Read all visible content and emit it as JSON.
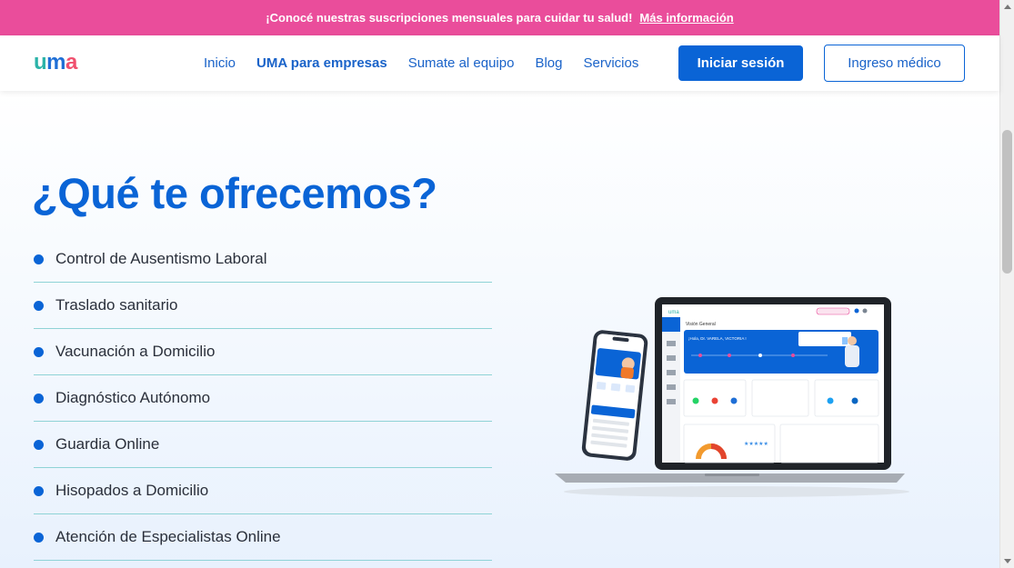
{
  "promo": {
    "text": "¡Conocé nuestras suscripciones mensuales para cuidar tu salud!",
    "link": "Más información"
  },
  "header": {
    "logo": {
      "u": "u",
      "m": "m",
      "a": "a"
    },
    "nav": [
      "Inicio",
      "UMA para empresas",
      "Sumate al equipo",
      "Blog",
      "Servicios"
    ],
    "login_label": "Iniciar sesión",
    "medico_label": "Ingreso médico"
  },
  "main": {
    "title": "¿Qué te ofrecemos?",
    "services": [
      "Control de Ausentismo Laboral",
      "Traslado sanitario",
      "Vacunación a Domicilio",
      "Diagnóstico Autónomo",
      "Guardia Online",
      "Hisopados a Domicilio",
      "Atención de Especialistas Online"
    ]
  },
  "mockup": {
    "dashboard_title": "Visión General",
    "greeting": "¡Hola, Dr. VARELA, VICTORIA !"
  },
  "colors": {
    "brand": "#0a64d6",
    "promo": "#ea4d9b",
    "divider": "#8fd3d6"
  },
  "icons": [
    "laptop-icon",
    "phone-icon",
    "bullet-dot-icon"
  ]
}
